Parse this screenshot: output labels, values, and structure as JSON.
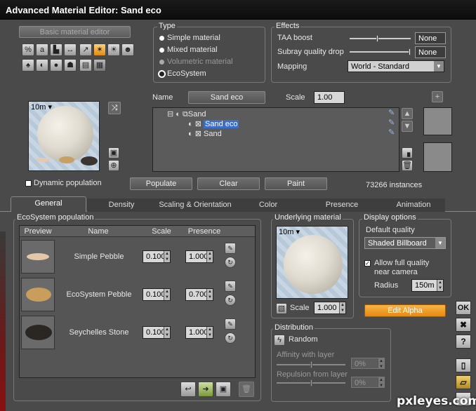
{
  "window": {
    "title": "Advanced Material Editor: Sand eco"
  },
  "basic_editor_label": "Basic material editor",
  "type_group": {
    "label": "Type",
    "options": [
      {
        "label": "Simple material",
        "selected": false,
        "enabled": true
      },
      {
        "label": "Mixed material",
        "selected": false,
        "enabled": true
      },
      {
        "label": "Volumetric material",
        "selected": false,
        "enabled": false
      },
      {
        "label": "EcoSystem",
        "selected": true,
        "enabled": true
      }
    ]
  },
  "effects": {
    "label": "Effects",
    "taa_boost": {
      "label": "TAA boost",
      "value": "None",
      "level": 0.45
    },
    "subray": {
      "label": "Subray quality drop",
      "value": "None",
      "level": 1.0
    },
    "mapping": {
      "label": "Mapping",
      "value": "World - Standard"
    }
  },
  "preview": {
    "distance": "10m",
    "dynamic_population_label": "Dynamic population"
  },
  "name_row": {
    "name_label": "Name",
    "name_value": "Sand eco",
    "scale_label": "Scale",
    "scale_value": "1.00"
  },
  "tree": [
    {
      "label": "Sand",
      "level": 0
    },
    {
      "label": "Sand eco",
      "level": 1,
      "selected": true
    },
    {
      "label": "Sand",
      "level": 1
    }
  ],
  "actions": {
    "populate": "Populate",
    "clear": "Clear",
    "paint": "Paint",
    "instances": "73266 instances"
  },
  "tabs": [
    "General",
    "Density",
    "Scaling & Orientation",
    "Color",
    "Presence",
    "Animation"
  ],
  "ecosystem": {
    "label": "EcoSystem population",
    "columns": [
      "Preview",
      "Name",
      "Scale",
      "Presence"
    ],
    "rows": [
      {
        "name": "Simple Pebble",
        "scale": "0.100",
        "presence": "1.000"
      },
      {
        "name": "EcoSystem Pebble",
        "scale": "0.100",
        "presence": "0.700"
      },
      {
        "name": "Seychelles Stone",
        "scale": "0.100",
        "presence": "1.000"
      }
    ]
  },
  "underlying": {
    "label": "Underlying material",
    "distance": "10m",
    "scale_label": "Scale",
    "scale_value": "1.000"
  },
  "display_options": {
    "label": "Display options",
    "default_quality_label": "Default quality",
    "default_quality_value": "Shaded Billboard",
    "allow_full_label_1": "Allow full quality",
    "allow_full_label_2": "near camera",
    "radius_label": "Radius",
    "radius_value": "150m"
  },
  "edit_alpha": "Edit Alpha",
  "distribution": {
    "label": "Distribution",
    "random_label": "Random",
    "affinity_label": "Affinity with layer",
    "affinity_value": "0%",
    "repulsion_label": "Repulsion from layer",
    "repulsion_value": "0%"
  },
  "side_buttons": {
    "ok": "OK",
    "cancel": "✖",
    "help": "?"
  },
  "watermark": "pxleyes.com",
  "accent": "#f0a020"
}
